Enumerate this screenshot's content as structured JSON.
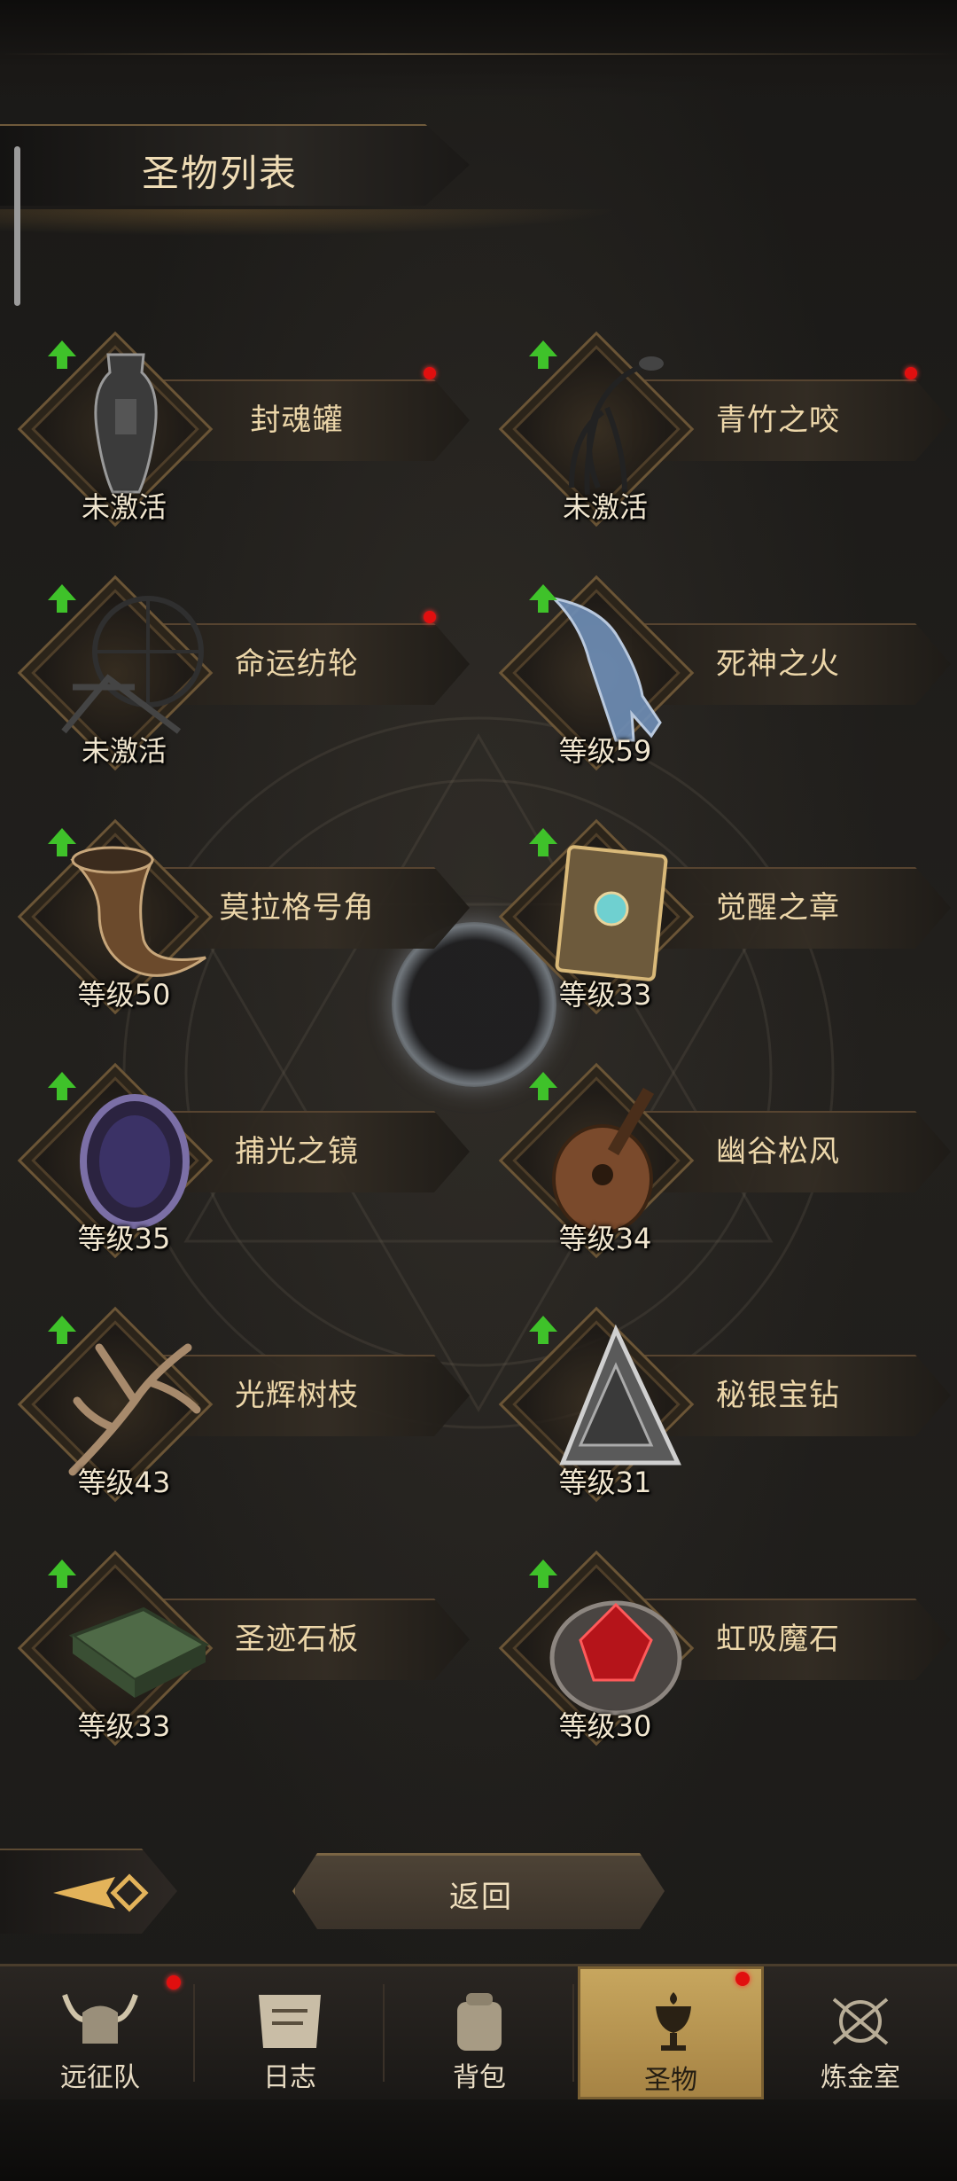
{
  "header": {
    "title": "圣物列表"
  },
  "relics": [
    {
      "name": "封魂罐",
      "status": "未激活",
      "has_dot": true
    },
    {
      "name": "青竹之咬",
      "status": "未激活",
      "has_dot": true
    },
    {
      "name": "命运纺轮",
      "status": "未激活",
      "has_dot": true
    },
    {
      "name": "死神之火",
      "status": "等级59",
      "has_dot": false
    },
    {
      "name": "莫拉格号角",
      "status": "等级50",
      "has_dot": false
    },
    {
      "name": "觉醒之章",
      "status": "等级33",
      "has_dot": false
    },
    {
      "name": "捕光之镜",
      "status": "等级35",
      "has_dot": false
    },
    {
      "name": "幽谷松风",
      "status": "等级34",
      "has_dot": false
    },
    {
      "name": "光辉树枝",
      "status": "等级43",
      "has_dot": false
    },
    {
      "name": "秘银宝钻",
      "status": "等级31",
      "has_dot": false
    },
    {
      "name": "圣迹石板",
      "status": "等级33",
      "has_dot": false
    },
    {
      "name": "虹吸魔石",
      "status": "等级30",
      "has_dot": false
    }
  ],
  "footer": {
    "back_label": "返回"
  },
  "nav": {
    "items": [
      {
        "label": "远征队",
        "icon": "helmet-icon",
        "has_dot": true,
        "active": false
      },
      {
        "label": "日志",
        "icon": "scroll-icon",
        "has_dot": false,
        "active": false
      },
      {
        "label": "背包",
        "icon": "backpack-icon",
        "has_dot": false,
        "active": false
      },
      {
        "label": "圣物",
        "icon": "chalice-icon",
        "has_dot": true,
        "active": true
      },
      {
        "label": "炼金室",
        "icon": "alchemy-icon",
        "has_dot": false,
        "active": false
      }
    ]
  },
  "colors": {
    "accent": "#c7a65e",
    "text": "#ecd6a9",
    "badge": "#e10f0f",
    "upgrade": "#3fc22a"
  }
}
